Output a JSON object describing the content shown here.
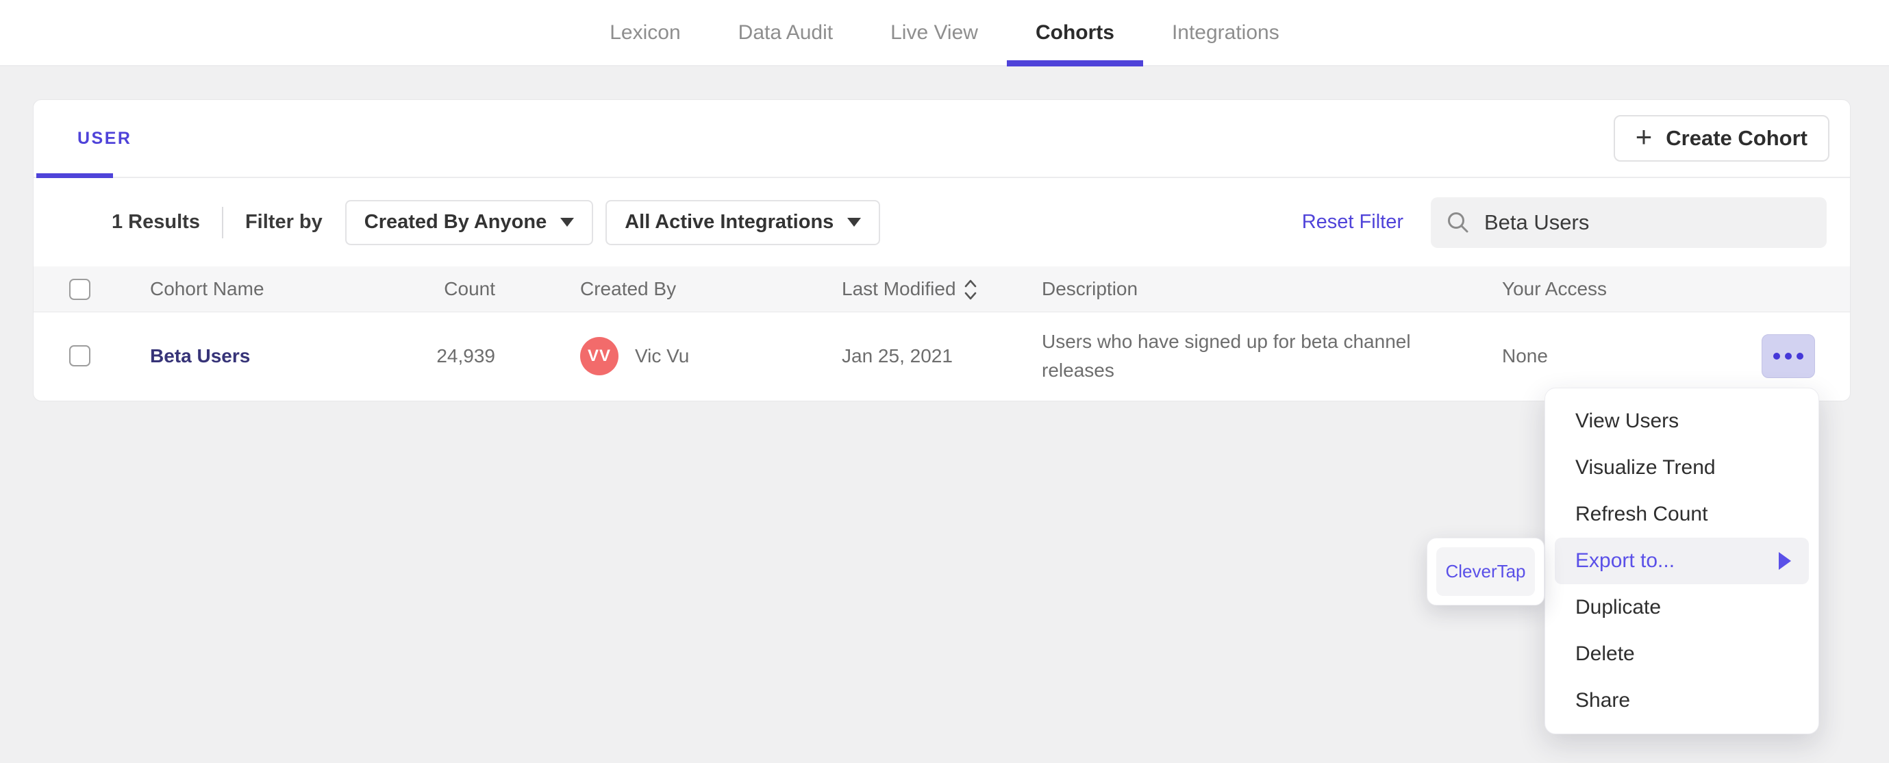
{
  "nav": {
    "tabs": [
      {
        "label": "Lexicon",
        "active": false
      },
      {
        "label": "Data Audit",
        "active": false
      },
      {
        "label": "Live View",
        "active": false
      },
      {
        "label": "Cohorts",
        "active": true
      },
      {
        "label": "Integrations",
        "active": false
      }
    ]
  },
  "card": {
    "type_tab": "USER",
    "create_cohort": {
      "label": "Create Cohort",
      "icon": "plus-icon"
    },
    "filters": {
      "results_count": "1 Results",
      "filter_by": "Filter by",
      "created_by_filter": "Created By Anyone",
      "integrations_filter": "All Active Integrations",
      "reset_filter": "Reset Filter",
      "search_value": "Beta Users"
    },
    "table": {
      "columns": [
        "Cohort Name",
        "Count",
        "Created By",
        "Last Modified",
        "Description",
        "Your Access"
      ],
      "rows": [
        {
          "name": "Beta Users",
          "count": "24,939",
          "creator_initials": "VV",
          "creator_name": "Vic Vu",
          "last_modified": "Jan 25, 2021",
          "description": "Users who have signed up for beta channel releases",
          "access": "None"
        }
      ]
    }
  },
  "context_menu": {
    "items": [
      {
        "label": "View Users"
      },
      {
        "label": "Visualize Trend"
      },
      {
        "label": "Refresh Count"
      },
      {
        "label": "Export to...",
        "highlighted": true,
        "has_submenu": true
      },
      {
        "label": "Duplicate"
      },
      {
        "label": "Delete"
      },
      {
        "label": "Share"
      }
    ]
  },
  "export_submenu": {
    "items": [
      {
        "label": "CleverTap"
      }
    ]
  },
  "colors": {
    "accent_purple": "#4f43d9",
    "menu_highlight_purple": "#5a50e8",
    "cohort_link": "#373478",
    "avatar_coral": "#f26b6b",
    "actions_button_bg": "#d2d2f1"
  }
}
